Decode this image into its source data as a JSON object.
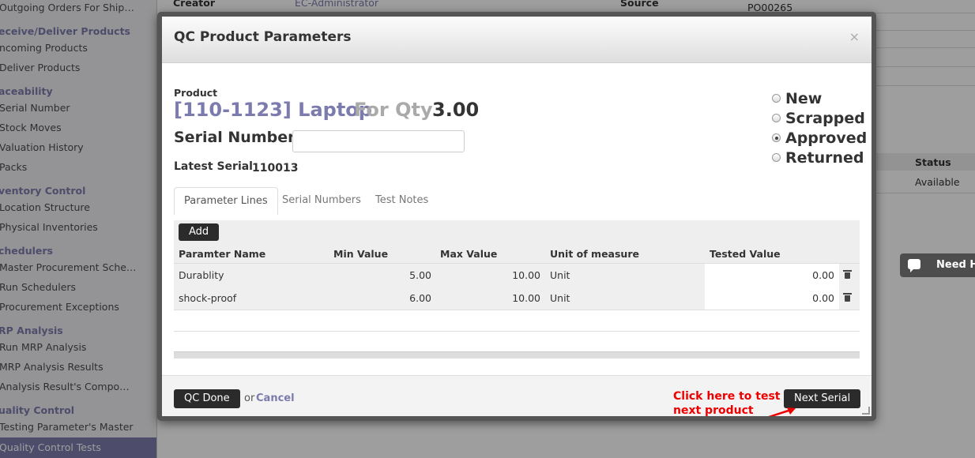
{
  "sidebar": {
    "items": [
      {
        "label": "Outgoing Orders For Ship…",
        "type": "item"
      },
      {
        "label": "eceive/Deliver Products",
        "type": "section"
      },
      {
        "label": "ncoming Products",
        "type": "item"
      },
      {
        "label": "Deliver Products",
        "type": "item"
      },
      {
        "label": "aceability",
        "type": "section"
      },
      {
        "label": "Serial Number",
        "type": "item"
      },
      {
        "label": "Stock Moves",
        "type": "item"
      },
      {
        "label": "Valuation History",
        "type": "item"
      },
      {
        "label": "Packs",
        "type": "item"
      },
      {
        "label": "ventory Control",
        "type": "section"
      },
      {
        "label": "Location Structure",
        "type": "item"
      },
      {
        "label": "Physical Inventories",
        "type": "item"
      },
      {
        "label": "chedulers",
        "type": "section"
      },
      {
        "label": "Master Procurement Sche…",
        "type": "item"
      },
      {
        "label": "Run Schedulers",
        "type": "item"
      },
      {
        "label": "Procurement Exceptions",
        "type": "item"
      },
      {
        "label": "RP Analysis",
        "type": "section"
      },
      {
        "label": "Run MRP Analysis",
        "type": "item"
      },
      {
        "label": "MRP Analysis Results",
        "type": "item"
      },
      {
        "label": "Analysis Result's Compo…",
        "type": "item"
      },
      {
        "label": "uality Control",
        "type": "section"
      },
      {
        "label": "Testing Parameter's Master",
        "type": "item"
      }
    ],
    "active_item": "Quality Control Tests"
  },
  "background": {
    "creator_label": "Creator",
    "creator_value": "EC-Administrator",
    "source_label": "Source",
    "source_value": "PO00265",
    "status_header": "Status",
    "status_value": "Available",
    "need_help": "Need H"
  },
  "dialog": {
    "title": "QC Product Parameters",
    "close": "×",
    "product_label": "Product",
    "product_name": "[110-1123] Laptop",
    "for_qty_label": "For Qty",
    "qty": "3.00",
    "serial_label": "Serial Number",
    "serial_value": "",
    "latest_serial_label": "Latest Serial",
    "latest_serial_value": "110013",
    "statuses": [
      {
        "label": "New",
        "checked": false
      },
      {
        "label": "Scrapped",
        "checked": false
      },
      {
        "label": "Approved",
        "checked": true
      },
      {
        "label": "Returned",
        "checked": false
      }
    ],
    "tabs": [
      {
        "label": "Parameter Lines",
        "active": true
      },
      {
        "label": "Serial Numbers",
        "active": false
      },
      {
        "label": "Test Notes",
        "active": false
      }
    ],
    "add_label": "Add",
    "columns": [
      "Paramter Name",
      "Min Value",
      "Max Value",
      "Unit of measure",
      "Tested Value"
    ],
    "rows": [
      {
        "name": "Durablity",
        "min": "5.00",
        "max": "10.00",
        "uom": "Unit",
        "tested": "0.00"
      },
      {
        "name": "shock-proof",
        "min": "6.00",
        "max": "10.00",
        "uom": "Unit",
        "tested": "0.00"
      }
    ],
    "qc_done_label": "QC Done",
    "or_text": "or",
    "cancel_label": "Cancel",
    "next_serial_label": "Next Serial",
    "annotation_line1": "Click here to test",
    "annotation_line2": "next product"
  },
  "colors": {
    "accent": "#7c7bad",
    "button_dark": "#2b2b2b",
    "annotation": "#e00000"
  }
}
